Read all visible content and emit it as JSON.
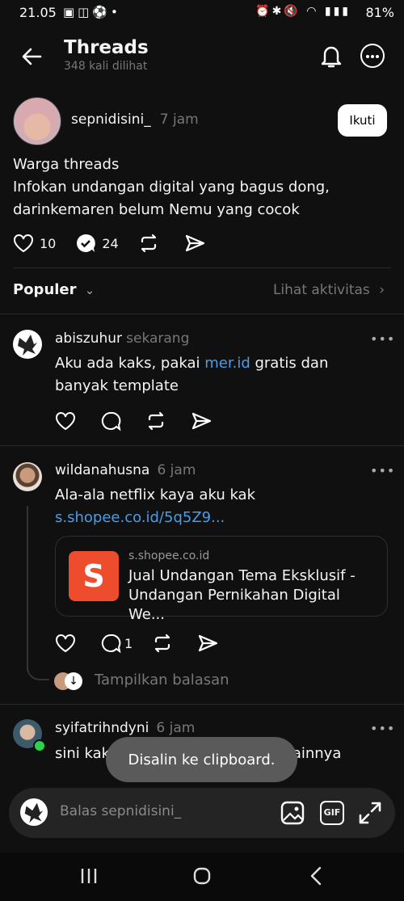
{
  "status_bar": {
    "time": "21.05",
    "battery": "81%"
  },
  "header": {
    "title": "Threads",
    "views": "348 kali dilihat"
  },
  "post": {
    "username": "sepnidisini_",
    "time": "7 jam",
    "follow_label": "Ikuti",
    "text": "Warga threads\nInfokan undangan digital yang bagus dong,\ndarinkemaren belum Nemu yang cocok",
    "likes": "10",
    "reposts": "24"
  },
  "sort": {
    "label": "Populer",
    "activity_label": "Lihat aktivitas"
  },
  "replies": [
    {
      "username": "abiszuhur",
      "time": "sekarang",
      "text_before": "Aku ada kaks, pakai ",
      "link": "mer.id",
      "text_after": " gratis dan banyak template"
    },
    {
      "username": "wildanahusna",
      "time": "6 jam",
      "text": "Ala-ala netflix kaya aku kak",
      "link": "s.shopee.co.id/5q5Z9...",
      "card": {
        "logo": "S",
        "domain": "s.shopee.co.id",
        "title": "Jual Undangan Tema Eksklusif - Undangan Pernikahan Digital We..."
      },
      "reply_count": "1",
      "show_replies_label": "Tampilkan balasan"
    },
    {
      "username": "syifatrihndyni",
      "time": "6 jam",
      "text": "sini kak dm aku, aku banyak desainnya"
    }
  ],
  "toast": "Disalin ke clipboard.",
  "composer": {
    "placeholder": "Balas sepnidisini_",
    "gif_label": "GIF"
  },
  "colors": {
    "background": "#101010",
    "link": "#4a9de6",
    "shopee": "#ee4d2d"
  }
}
